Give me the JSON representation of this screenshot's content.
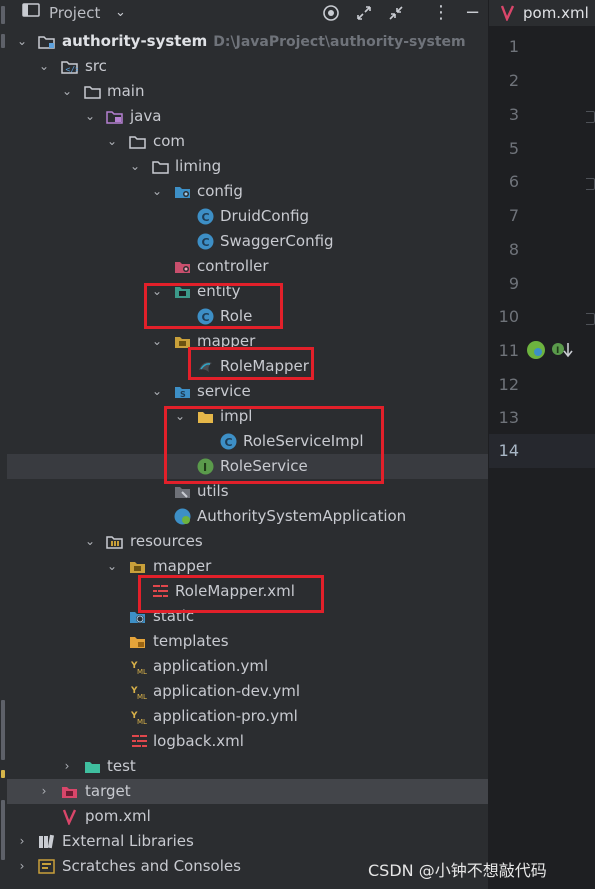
{
  "toolbar": {
    "title": "Project"
  },
  "tree": {
    "root": {
      "name": "authority-system",
      "path": "D:\\JavaProject\\authority-system"
    },
    "src": "src",
    "main": "main",
    "java": "java",
    "com": "com",
    "liming": "liming",
    "config": "config",
    "druid_config": "DruidConfig",
    "swagger_config": "SwaggerConfig",
    "controller": "controller",
    "entity": "entity",
    "role": "Role",
    "mapper": "mapper",
    "role_mapper": "RoleMapper",
    "service": "service",
    "impl": "impl",
    "role_service_impl": "RoleServiceImpl",
    "role_service": "RoleService",
    "utils": "utils",
    "app": "AuthoritySystemApplication",
    "resources": "resources",
    "res_mapper": "mapper",
    "role_mapper_xml": "RoleMapper.xml",
    "static": "static",
    "templates": "templates",
    "application_yml": "application.yml",
    "application_dev_yml": "application-dev.yml",
    "application_pro_yml": "application-pro.yml",
    "logback_xml": "logback.xml",
    "test": "test",
    "target": "target",
    "pom_xml": "pom.xml",
    "external_libraries": "External Libraries",
    "scratches": "Scratches and Consoles"
  },
  "editor": {
    "tab_label": "pom.xml",
    "line_numbers": [
      "1",
      "2",
      "3",
      "5",
      "6",
      "7",
      "8",
      "9",
      "10",
      "11",
      "12",
      "13",
      "14"
    ]
  },
  "watermark": "CSDN @小钟不想敲代码",
  "colors": {
    "highlight_box": "#e2202a",
    "folder": "#5fa2dd",
    "class_icon": "#3d8fc6",
    "interface_icon": "#5a9a4b",
    "xml_icon": "#e0474c"
  }
}
